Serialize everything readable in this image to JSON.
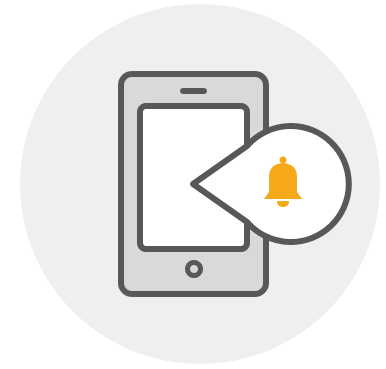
{
  "illustration": {
    "icon": "mobile-notification-icon",
    "colors": {
      "background_circle": "#efefef",
      "outline": "#58585a",
      "phone_body": "#d9d9d9",
      "phone_screen": "#ffffff",
      "bubble": "#ffffff",
      "bell": "#f6a81b"
    }
  }
}
